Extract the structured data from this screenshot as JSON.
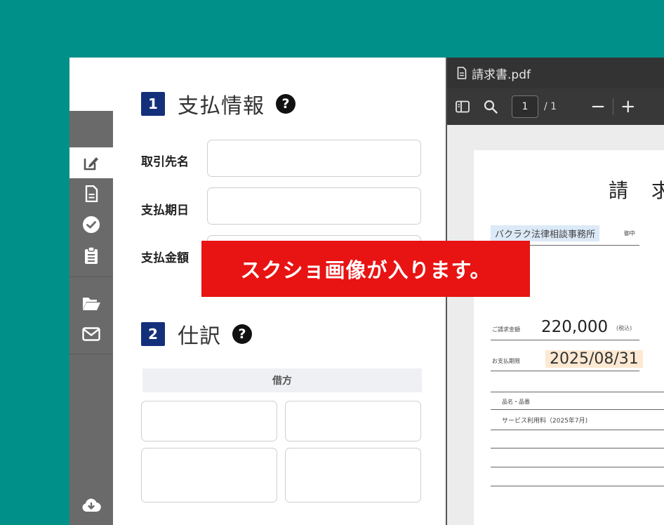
{
  "colors": {
    "background": "#00908a",
    "rail": "#6a6a6a",
    "section_badge": "#14307a",
    "overlay": "#e81313",
    "viewer_bar": "#333333"
  },
  "rail": {
    "icons": [
      "edit-icon",
      "document-icon",
      "check-circle-icon",
      "clipboard-list-icon",
      "folder-open-icon",
      "envelope-icon",
      "cloud-download-icon"
    ],
    "active": "edit-icon"
  },
  "form": {
    "section1": {
      "number": "1",
      "title": "支払情報",
      "help": "?"
    },
    "fields": [
      {
        "label": "取引先名",
        "value": ""
      },
      {
        "label": "支払期日",
        "value": ""
      },
      {
        "label": "支払金額",
        "value": ""
      }
    ],
    "section2": {
      "number": "2",
      "title": "仕訳",
      "help": "?"
    },
    "journal": {
      "debit_header": "借方"
    }
  },
  "viewer": {
    "file_name": "請求書.pdf",
    "page_current": "1",
    "page_total": "/ 1",
    "zoom_out": "−",
    "zoom_in": "+",
    "document": {
      "title": "請 求",
      "recipient": "バクラク法律相談事務所",
      "honorific": "御中",
      "amount_label": "ご請求金額",
      "amount": "220,000",
      "tax_note": "(税込)",
      "due_label": "お支払期限",
      "due_date": "2025/08/31",
      "table_header": "品名・品番",
      "items": [
        "サービス利用料（2025年7月)"
      ]
    }
  },
  "overlay": {
    "text": "スクショ画像が入ります。"
  }
}
